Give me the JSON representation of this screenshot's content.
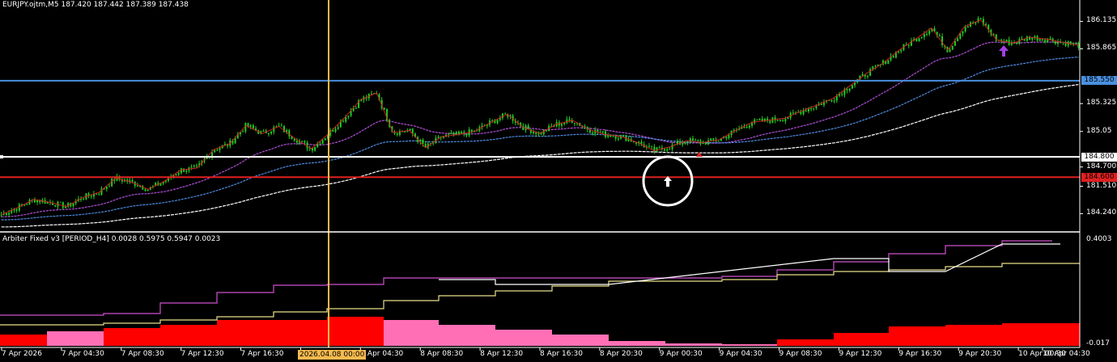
{
  "header": {
    "symbol_line": "EURJPY.ojtm,M5 187.420 187.442 187.389 187.438"
  },
  "indicator": {
    "label": "Arbiter Fixed v3 [PERIOD_H4] 0.0028 0.5975 0.5947 0.0023",
    "scale_max": "0.4003",
    "scale_min": "-0.017"
  },
  "price_axis": {
    "ticks": [
      {
        "label": "186.135",
        "value": 186.135
      },
      {
        "label": "185.865",
        "value": 185.865
      },
      {
        "label": "185.325",
        "value": 185.325
      },
      {
        "label": "185.05",
        "value": 185.05
      },
      {
        "label": "184.700",
        "value": 184.7
      },
      {
        "label": "181.510",
        "value": 184.51
      },
      {
        "label": "184.240",
        "value": 184.24
      }
    ],
    "tags": [
      {
        "label": "185.550",
        "value": 185.55,
        "bg": "#4a8fe0",
        "fg": "#000000"
      },
      {
        "label": "184.800",
        "value": 184.8,
        "bg": "#ffffff",
        "fg": "#000000"
      },
      {
        "label": "184.600",
        "value": 184.6,
        "bg": "#e02020",
        "fg": "#000000"
      }
    ]
  },
  "time_axis": {
    "ticks": [
      "7 Apr 2026",
      "7 Apr 04:30",
      "7 Apr 08:30",
      "7 Apr 12:30",
      "7 Apr 16:30",
      "7 Apr 20:30",
      "8 Apr 04:30",
      "8 Apr 08:30",
      "8 Apr 12:30",
      "8 Apr 16:30",
      "8 Apr 20:30",
      "9 Apr 00:30",
      "9 Apr 04:30",
      "9 Apr 08:30",
      "9 Apr 12:30",
      "9 Apr 16:30",
      "9 Apr 20:30",
      "10 Apr 00:30",
      "10 Apr 04:30"
    ],
    "cursor_label": "2026.04.08 00:00"
  },
  "colors": {
    "candles": "#22cc22",
    "zigzag": "#cc2020",
    "ma_purple": "#b24fd8",
    "ma_blue": "#4f8ce0",
    "ma_white": "#ffffff",
    "hline_blue": "#4a8fe0",
    "hline_white": "#ffffff",
    "hline_red": "#e02020",
    "crosshair": "#f6b94e",
    "hist_red": "#ff0000",
    "hist_pink": "#ff6fb5",
    "step_magenta": "#d050d0",
    "step_yellow": "#e8e08a",
    "step_white": "#ffffff",
    "arrow_purple": "#a040e0"
  },
  "chart_data": {
    "type": "line",
    "series": [
      {
        "values": [
          184.23,
          184.3,
          184.38,
          184.35,
          184.31,
          184.4,
          184.45,
          184.59,
          184.55,
          184.48,
          184.56,
          184.67,
          184.69,
          184.87,
          184.93,
          185.11,
          185.03,
          185.1,
          184.98,
          184.88,
          185.02,
          185.18,
          185.36,
          185.43,
          185.04,
          185.06,
          184.89,
          185.0,
          185.02,
          185.05,
          185.14,
          185.22,
          185.09,
          185.03,
          185.12,
          185.16,
          185.07,
          185.02,
          185.0,
          184.94,
          184.86,
          184.9,
          184.96,
          184.94,
          184.97,
          185.06,
          185.14,
          185.16,
          185.18,
          185.25,
          185.31,
          185.38,
          185.5,
          185.62,
          185.72,
          185.85,
          185.96,
          186.07,
          185.85,
          186.08,
          186.15,
          185.95,
          185.92,
          185.98,
          185.96,
          185.93,
          185.9
        ],
        "x_range": [
          "7 Apr 2026",
          "10 Apr 04:30"
        ]
      }
    ],
    "ylim": [
      184.1,
      186.25
    ],
    "horizontal_levels": [
      185.55,
      184.8,
      184.6
    ]
  }
}
